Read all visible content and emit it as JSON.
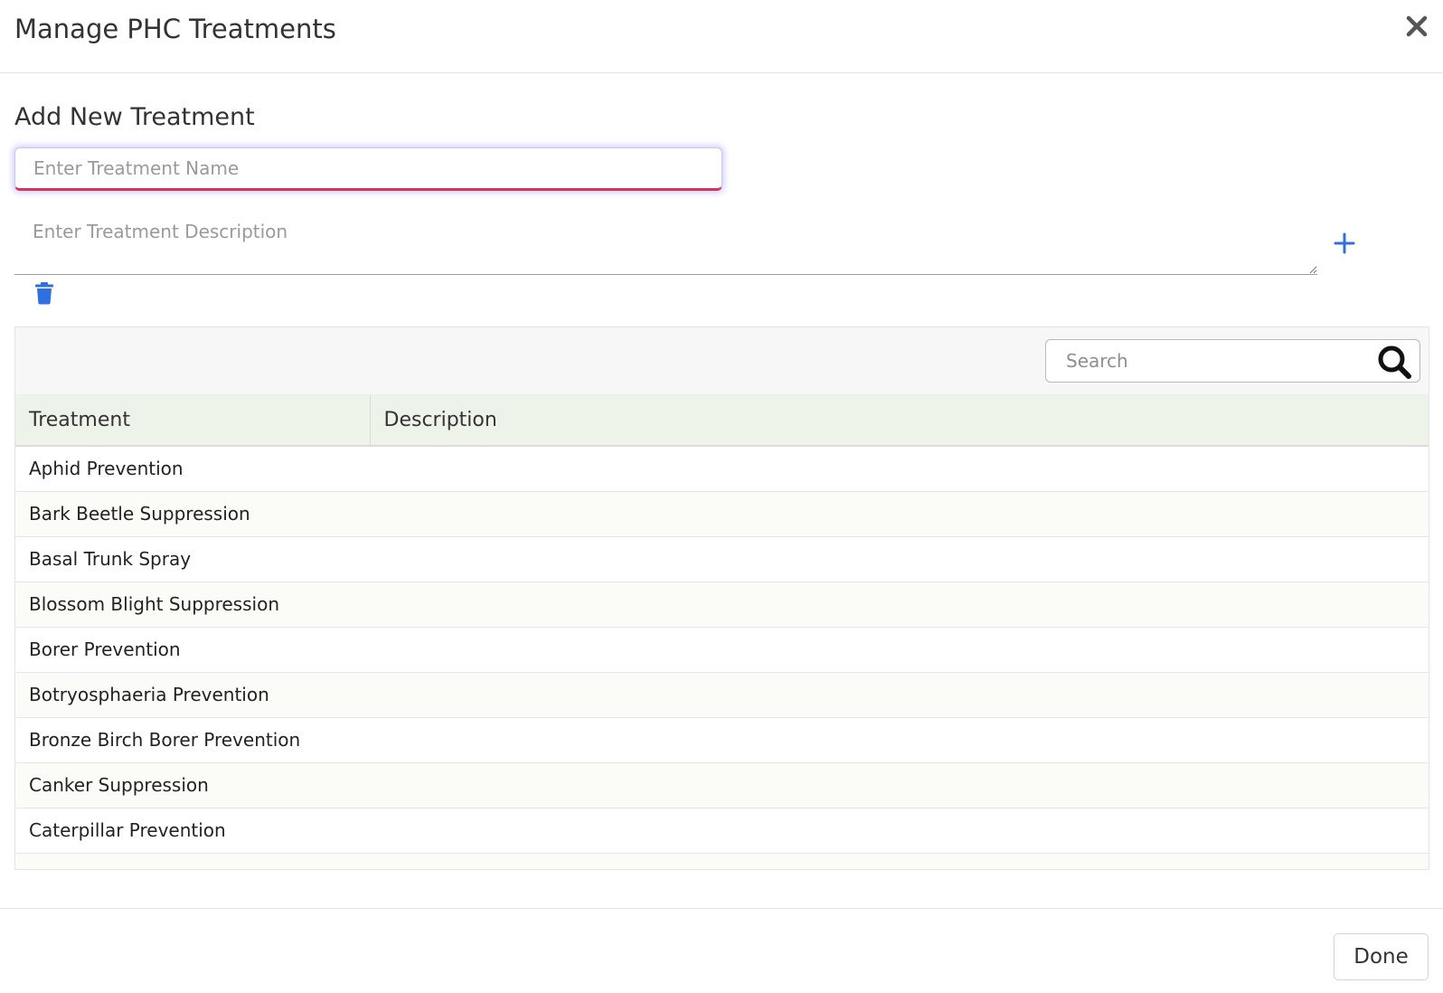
{
  "modal": {
    "title": "Manage PHC Treatments",
    "close_icon": "close-icon"
  },
  "add_form": {
    "title": "Add New Treatment",
    "name_placeholder": "Enter Treatment Name",
    "name_value": "",
    "description_placeholder": "Enter Treatment Description",
    "description_value": "",
    "add_icon": "plus-icon",
    "delete_icon": "trash-icon",
    "accent_color": "#2f6fe0"
  },
  "table": {
    "search_placeholder": "Search",
    "search_icon": "search-icon",
    "columns": [
      "Treatment",
      "Description"
    ],
    "rows": [
      {
        "treatment": "Aphid Prevention",
        "description": ""
      },
      {
        "treatment": "Bark Beetle Suppression",
        "description": ""
      },
      {
        "treatment": "Basal Trunk Spray",
        "description": ""
      },
      {
        "treatment": "Blossom Blight Suppression",
        "description": ""
      },
      {
        "treatment": "Borer Prevention",
        "description": ""
      },
      {
        "treatment": "Botryosphaeria Prevention",
        "description": ""
      },
      {
        "treatment": "Bronze Birch Borer Prevention",
        "description": ""
      },
      {
        "treatment": "Canker Suppression",
        "description": ""
      },
      {
        "treatment": "Caterpillar Prevention",
        "description": ""
      }
    ]
  },
  "footer": {
    "done_label": "Done"
  }
}
